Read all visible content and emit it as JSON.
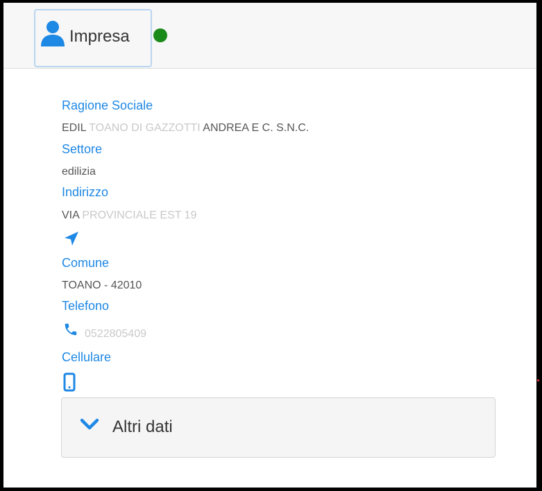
{
  "header": {
    "tab_label": "Impresa",
    "tab_icon": "user-icon",
    "status_color": "#1a8a1a"
  },
  "fields": {
    "ragione_sociale": {
      "label": "Ragione Sociale",
      "value_prefix": "EDIL ",
      "value_blurred": "TOANO DI GAZZOTTI",
      "value_suffix": " ANDREA E C. S.N.C."
    },
    "settore": {
      "label": "Settore",
      "value": "edilizia"
    },
    "indirizzo": {
      "label": "Indirizzo",
      "value_prefix": "VIA ",
      "value_blurred": "PROVINCIALE EST 19",
      "icon": "navigation-arrow-icon"
    },
    "comune": {
      "label": "Comune",
      "value": "TOANO - 42010"
    },
    "telefono": {
      "label": "Telefono",
      "value": "0522805409",
      "icon": "phone-icon"
    },
    "cellulare": {
      "label": "Cellulare",
      "icon": "mobile-phone-icon"
    }
  },
  "accordion": {
    "label": "Altri dati",
    "icon": "chevron-down-icon",
    "expanded": false
  },
  "colors": {
    "accent": "#1e88e5",
    "value_text": "#555555",
    "blurred_text": "#c9c9c9"
  }
}
